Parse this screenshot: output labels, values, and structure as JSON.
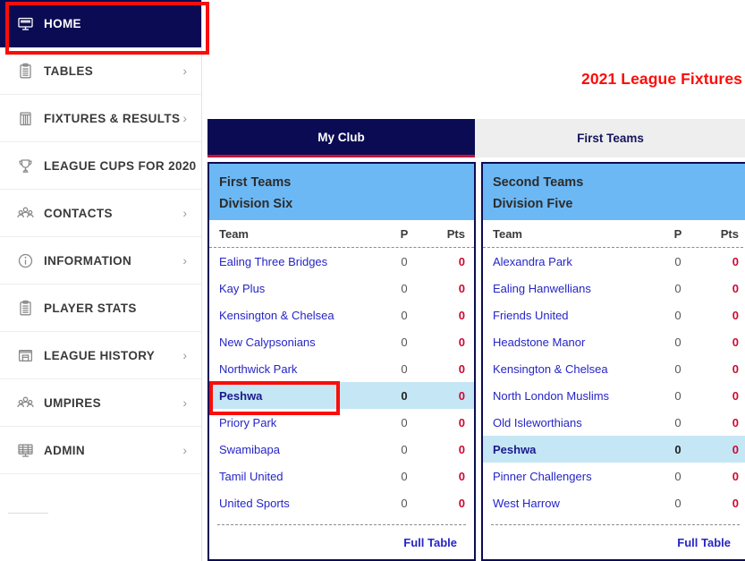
{
  "sidebar": {
    "items": [
      {
        "label": "HOME",
        "icon": "monitor-icon",
        "active": true,
        "chevron": false
      },
      {
        "label": "TABLES",
        "icon": "clipboard-icon",
        "active": false,
        "chevron": true
      },
      {
        "label": "FIXTURES & RESULTS",
        "icon": "stumps-icon",
        "active": false,
        "chevron": true
      },
      {
        "label": "LEAGUE CUPS FOR 2020",
        "icon": "trophy-icon",
        "active": false,
        "chevron": false
      },
      {
        "label": "CONTACTS",
        "icon": "people-icon",
        "active": false,
        "chevron": true
      },
      {
        "label": "INFORMATION",
        "icon": "info-icon",
        "active": false,
        "chevron": true
      },
      {
        "label": "PLAYER STATS",
        "icon": "clipboard-icon",
        "active": false,
        "chevron": false
      },
      {
        "label": "LEAGUE HISTORY",
        "icon": "archive-icon",
        "active": false,
        "chevron": true
      },
      {
        "label": "UMPIRES",
        "icon": "people-icon",
        "active": false,
        "chevron": true
      },
      {
        "label": "ADMIN",
        "icon": "admin-monitor-icon",
        "active": false,
        "chevron": true
      }
    ]
  },
  "header": {
    "title": "2021 League Fixtures"
  },
  "tabs": [
    {
      "label": "My Club",
      "active": true
    },
    {
      "label": "First Teams",
      "active": false
    }
  ],
  "columns": {
    "team": "Team",
    "p": "P",
    "pts": "Pts"
  },
  "footer_link": "Full Table",
  "panels": [
    {
      "title_line1": "First Teams",
      "title_line2": "Division Six",
      "rows": [
        {
          "team": "Ealing Three Bridges",
          "p": "0",
          "pts": "0",
          "highlight": false
        },
        {
          "team": "Kay Plus",
          "p": "0",
          "pts": "0",
          "highlight": false
        },
        {
          "team": "Kensington & Chelsea",
          "p": "0",
          "pts": "0",
          "highlight": false
        },
        {
          "team": "New Calypsonians",
          "p": "0",
          "pts": "0",
          "highlight": false
        },
        {
          "team": "Northwick Park",
          "p": "0",
          "pts": "0",
          "highlight": false
        },
        {
          "team": "Peshwa",
          "p": "0",
          "pts": "0",
          "highlight": true
        },
        {
          "team": "Priory Park",
          "p": "0",
          "pts": "0",
          "highlight": false
        },
        {
          "team": "Swamibapa",
          "p": "0",
          "pts": "0",
          "highlight": false
        },
        {
          "team": "Tamil United",
          "p": "0",
          "pts": "0",
          "highlight": false
        },
        {
          "team": "United Sports",
          "p": "0",
          "pts": "0",
          "highlight": false
        }
      ]
    },
    {
      "title_line1": "Second Teams",
      "title_line2": "Division Five",
      "rows": [
        {
          "team": "Alexandra Park",
          "p": "0",
          "pts": "0",
          "highlight": false
        },
        {
          "team": "Ealing Hanwellians",
          "p": "0",
          "pts": "0",
          "highlight": false
        },
        {
          "team": "Friends United",
          "p": "0",
          "pts": "0",
          "highlight": false
        },
        {
          "team": "Headstone Manor",
          "p": "0",
          "pts": "0",
          "highlight": false
        },
        {
          "team": "Kensington & Chelsea",
          "p": "0",
          "pts": "0",
          "highlight": false
        },
        {
          "team": "North London Muslims",
          "p": "0",
          "pts": "0",
          "highlight": false
        },
        {
          "team": "Old Isleworthians",
          "p": "0",
          "pts": "0",
          "highlight": false
        },
        {
          "team": "Peshwa",
          "p": "0",
          "pts": "0",
          "highlight": true
        },
        {
          "team": "Pinner Challengers",
          "p": "0",
          "pts": "0",
          "highlight": false
        },
        {
          "team": "West Harrow",
          "p": "0",
          "pts": "0",
          "highlight": false
        }
      ]
    }
  ],
  "annotations": [
    {
      "name": "home-highlight",
      "color": "#fb0d09"
    },
    {
      "name": "peshwa-highlight",
      "color": "#fb0d09"
    }
  ],
  "colors": {
    "navy": "#0b0b54",
    "panel_head_blue": "#6cb8f5",
    "row_highlight": "#c5e7f5",
    "link_blue": "#2525c7",
    "pts_red": "#cc0933",
    "title_red": "#fb0d09",
    "tab_underline": "#c0143c"
  }
}
